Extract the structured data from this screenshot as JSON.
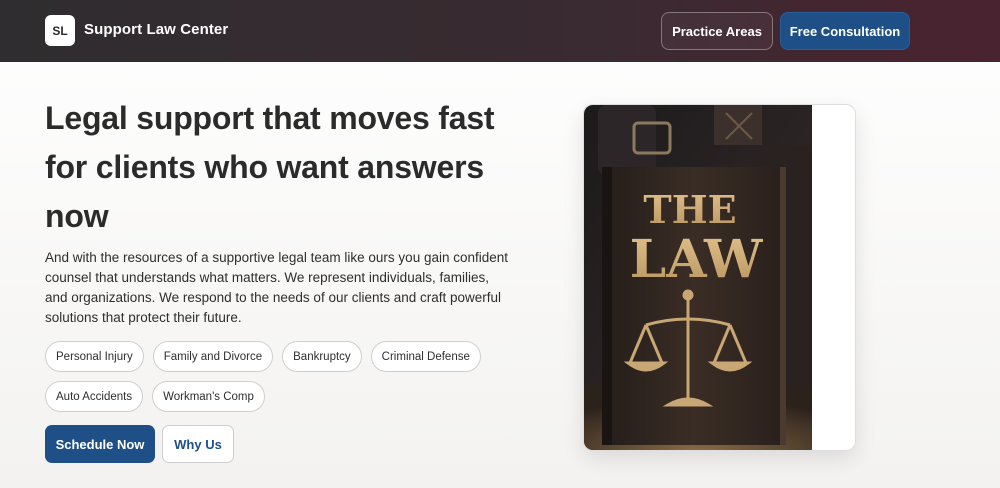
{
  "header": {
    "logo_initials": "SL",
    "brand_name": "Support Law Center",
    "nav": {
      "practice_areas": "Practice Areas",
      "free_consultation": "Free Consultation"
    }
  },
  "hero": {
    "headline": "Legal support that moves fast for clients who want answers now",
    "description": "And with the resources of a supportive legal team like ours you gain confident counsel that understands what matters. We represent individuals, families, and organizations. We respond to the needs of our clients and craft powerful solutions that protect their future.",
    "practice_tags": [
      "Personal Injury",
      "Family and Divorce",
      "Bankruptcy",
      "Criminal Defense",
      "Auto Accidents",
      "Workman's Comp"
    ],
    "cta_primary": "Schedule Now",
    "cta_secondary": "Why Us"
  },
  "image": {
    "book_title_line1": "THE",
    "book_title_line2": "LAW"
  },
  "colors": {
    "accent": "#1e4f86",
    "header_start": "#2f2d2f",
    "header_end": "#4a2330"
  },
  "icons": {
    "scales": "scales-of-justice-icon"
  }
}
